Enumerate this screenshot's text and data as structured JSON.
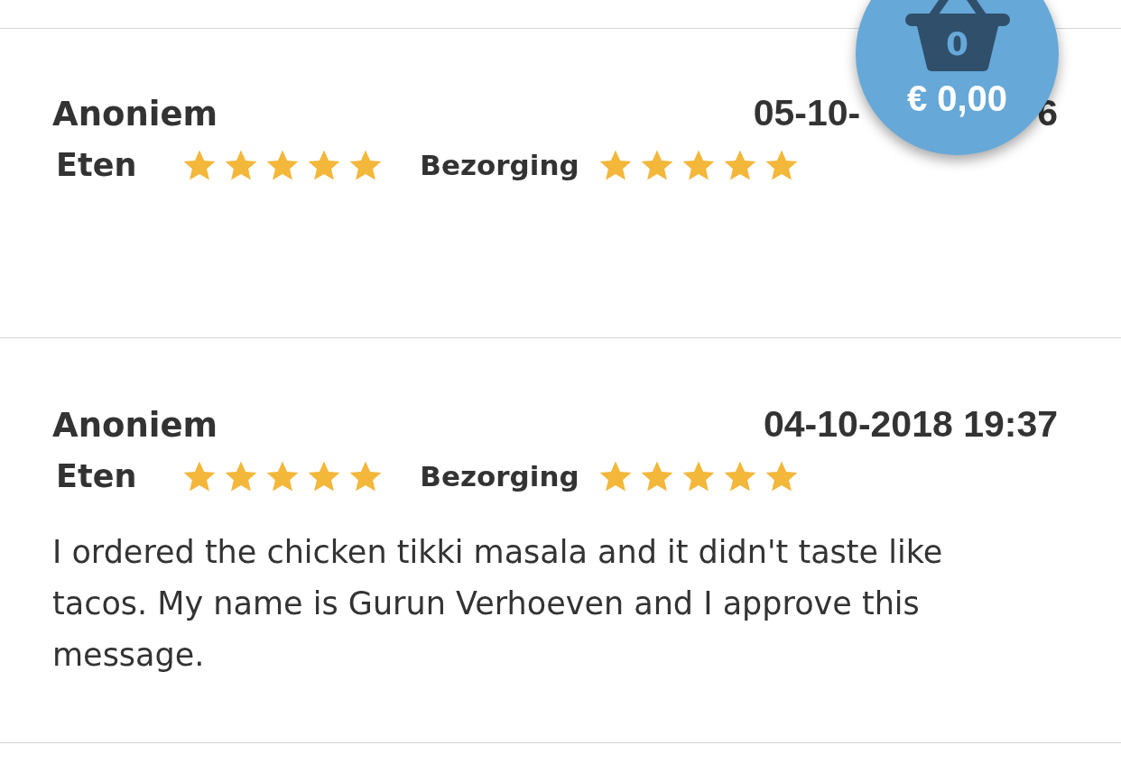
{
  "reviews": [
    {
      "author": "Anoniem",
      "date_parts": [
        "05-10-",
        "6"
      ],
      "ratings": [
        {
          "label": "Eten",
          "stars": 5
        },
        {
          "label": "Bezorging",
          "stars": 5
        }
      ]
    },
    {
      "author": "Anoniem",
      "date_parts": [
        "04-10-2018 19:37"
      ],
      "ratings": [
        {
          "label": "Eten",
          "stars": 5
        },
        {
          "label": "Bezorging",
          "stars": 5
        }
      ],
      "text": "I ordered the chicken tikki masala and it didn't taste like tacos. My name is Gurun Verhoeven and I approve this message."
    }
  ],
  "cart": {
    "count": "0",
    "total": "€ 0,00"
  }
}
